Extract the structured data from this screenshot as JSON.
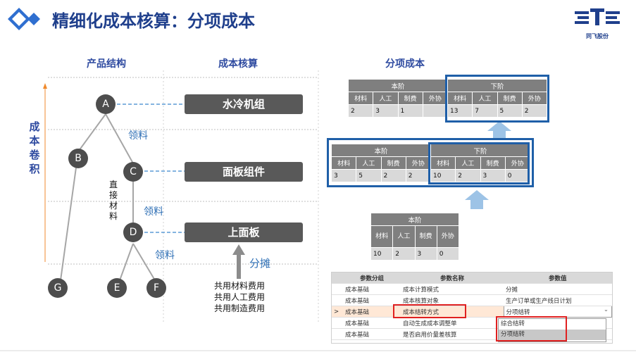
{
  "header": {
    "title": "精细化成本核算：分项成本",
    "logo_text": "同飞股份"
  },
  "columns": {
    "product": "产品结构",
    "costing": "成本核算",
    "item_cost": "分项成本"
  },
  "side_label": "成本卷积",
  "nodes": {
    "a": "A",
    "b": "B",
    "c": "C",
    "d": "D",
    "e": "E",
    "f": "F",
    "g": "G"
  },
  "labels": {
    "lingliao1": "领料",
    "lingliao2": "领料",
    "lingliao3": "领料",
    "direct_material": "直接材料",
    "allocate": "分摊"
  },
  "bars": {
    "top": "水冷机组",
    "mid": "面板组件",
    "bottom": "上面板"
  },
  "shared_costs": [
    "共用材料费用",
    "共用人工费用",
    "共用制造费用"
  ],
  "table_top": {
    "group1": "本阶",
    "group2": "下阶",
    "headers": [
      "材料",
      "人工",
      "制费",
      "外协",
      "材料",
      "人工",
      "制费",
      "外协"
    ],
    "values": [
      "2",
      "3",
      "1",
      "",
      "13",
      "7",
      "5",
      "2"
    ]
  },
  "table_mid": {
    "group1": "本阶",
    "group2": "下阶",
    "headers": [
      "材料",
      "人工",
      "制费",
      "外协",
      "材料",
      "人工",
      "制费",
      "外协"
    ],
    "values": [
      "3",
      "5",
      "2",
      "2",
      "10",
      "2",
      "3",
      "0"
    ]
  },
  "table_bottom": {
    "group1": "本阶",
    "headers": [
      "材料",
      "人工",
      "制费",
      "外协"
    ],
    "values": [
      "10",
      "2",
      "3",
      "0"
    ]
  },
  "params": {
    "headers": [
      "参数分组",
      "参数名称",
      "参数值"
    ],
    "rows": [
      {
        "marker": "",
        "group": "成本基础",
        "name": "成本计算模式",
        "value": "分摊"
      },
      {
        "marker": "",
        "group": "成本基础",
        "name": "成本核算对象",
        "value": "生产订单或生产线日计划"
      },
      {
        "marker": ">",
        "group": "成本基础",
        "name": "成本结转方式",
        "value": "分项结转"
      },
      {
        "marker": "",
        "group": "成本基础",
        "name": "自动生成成本调整单",
        "value": ""
      },
      {
        "marker": "",
        "group": "成本基础",
        "name": "是否启用价量差核算",
        "value": ""
      }
    ],
    "options": [
      "综合结转",
      "分项结转"
    ]
  }
}
